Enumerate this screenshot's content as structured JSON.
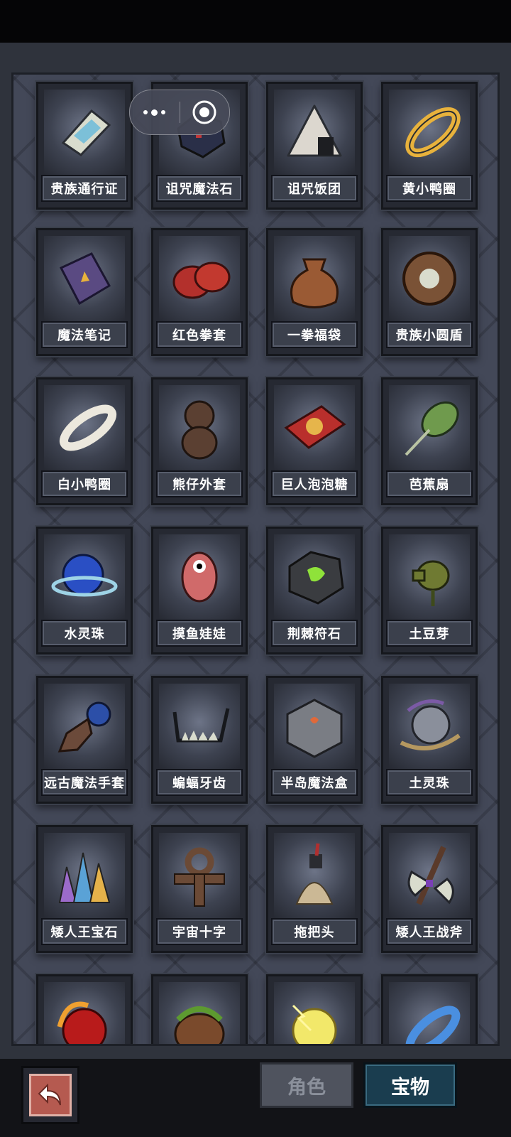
{
  "capsule": {
    "menu_icon": "more-dots-icon",
    "close_icon": "target-circle-icon"
  },
  "items": [
    {
      "label": "贵族通行证",
      "icon": "card-icon"
    },
    {
      "label": "诅咒魔法石",
      "icon": "dark-stone-icon"
    },
    {
      "label": "诅咒饭团",
      "icon": "rice-ball-icon"
    },
    {
      "label": "黄小鸭圈",
      "icon": "yellow-ring-icon"
    },
    {
      "label": "魔法笔记",
      "icon": "book-icon"
    },
    {
      "label": "红色拳套",
      "icon": "boxing-glove-icon"
    },
    {
      "label": "一拳福袋",
      "icon": "bag-icon"
    },
    {
      "label": "贵族小圆盾",
      "icon": "shield-icon"
    },
    {
      "label": "白小鸭圈",
      "icon": "white-ring-icon"
    },
    {
      "label": "熊仔外套",
      "icon": "bear-icon"
    },
    {
      "label": "巨人泡泡糖",
      "icon": "gum-box-icon"
    },
    {
      "label": "芭蕉扇",
      "icon": "fan-icon"
    },
    {
      "label": "水灵珠",
      "icon": "water-orb-icon"
    },
    {
      "label": "摸鱼娃娃",
      "icon": "doll-icon"
    },
    {
      "label": "荆棘符石",
      "icon": "rune-stone-icon"
    },
    {
      "label": "土豆芽",
      "icon": "sprout-icon"
    },
    {
      "label": "远古魔法手套",
      "icon": "gauntlet-icon"
    },
    {
      "label": "蝙蝠牙齿",
      "icon": "teeth-icon"
    },
    {
      "label": "半岛魔法盒",
      "icon": "cube-icon"
    },
    {
      "label": "土灵珠",
      "icon": "earth-orb-icon"
    },
    {
      "label": "矮人王宝石",
      "icon": "crystals-icon"
    },
    {
      "label": "宇宙十字",
      "icon": "cross-icon"
    },
    {
      "label": "拖把头",
      "icon": "mop-icon"
    },
    {
      "label": "矮人王战斧",
      "icon": "axe-icon"
    },
    {
      "label": "",
      "icon": "fire-orb-icon"
    },
    {
      "label": "",
      "icon": "plant-pot-icon"
    },
    {
      "label": "",
      "icon": "lightning-orb-icon"
    },
    {
      "label": "",
      "icon": "blue-ring-icon"
    }
  ],
  "bottom": {
    "back_icon": "back-arrow-icon",
    "tabs": [
      {
        "label": "角色",
        "active": false
      },
      {
        "label": "宝物",
        "active": true
      }
    ]
  }
}
